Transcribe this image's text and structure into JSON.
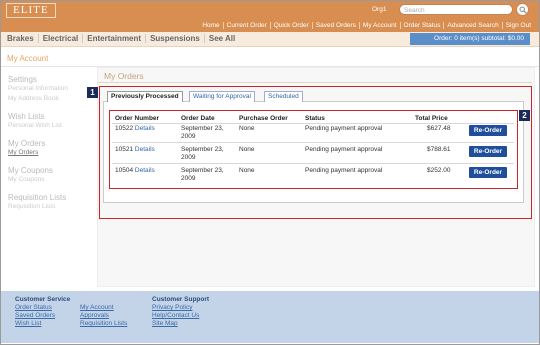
{
  "header": {
    "logo": "ELITE",
    "org": "Org1",
    "search_placeholder": "Search",
    "links": [
      "Home",
      "Current Order",
      "Quick Order",
      "Saved Orders",
      "My Account",
      "Order Status",
      "Advanced Search",
      "Sign Out"
    ]
  },
  "categories": [
    "Brakes",
    "Electrical",
    "Entertainment",
    "Suspensions",
    "See All"
  ],
  "cart": "Order: 0 item(s) subtotal: $0.00",
  "account_title": "My Account",
  "sidebar": {
    "settings": "Settings",
    "personal_info": "Personal Information",
    "address_book": "My Address Book",
    "wish_lists": "Wish Lists",
    "personal_wish": "Personal Wish List",
    "my_orders": "My Orders",
    "my_orders_link": "My Orders",
    "my_coupons": "My Coupons",
    "my_coupons_link": "My Coupons",
    "requisition": "Requisition Lists",
    "requisition_link": "Requisition Lists"
  },
  "orders": {
    "title": "My Orders",
    "tabs": [
      "Previously Processed",
      "Waiting for Approval",
      "Scheduled"
    ],
    "columns": [
      "Order Number",
      "Order Date",
      "Purchase Order",
      "Status",
      "Total Price"
    ],
    "rows": [
      {
        "number": "10522",
        "details": "Details",
        "date1": "September 23,",
        "date2": "2009",
        "po": "None",
        "status": "Pending payment approval",
        "total": "$627.48",
        "action": "Re-Order"
      },
      {
        "number": "10521",
        "details": "Details",
        "date1": "September 23,",
        "date2": "2009",
        "po": "None",
        "status": "Pending payment approval",
        "total": "$788.61",
        "action": "Re-Order"
      },
      {
        "number": "10504",
        "details": "Details",
        "date1": "September 23,",
        "date2": "2009",
        "po": "None",
        "status": "Pending payment approval",
        "total": "$252.00",
        "action": "Re-Order"
      }
    ]
  },
  "callouts": [
    "1",
    "2"
  ],
  "footer": {
    "service_title": "Customer Service",
    "service_links": [
      "Order Status",
      "Saved Orders",
      "Wish List"
    ],
    "account_links": [
      "My Account",
      "Approvals",
      "Requisition Lists"
    ],
    "support_title": "Customer Support",
    "support_links": [
      "Privacy Policy",
      "Help/Contact Us",
      "Site Map"
    ]
  }
}
